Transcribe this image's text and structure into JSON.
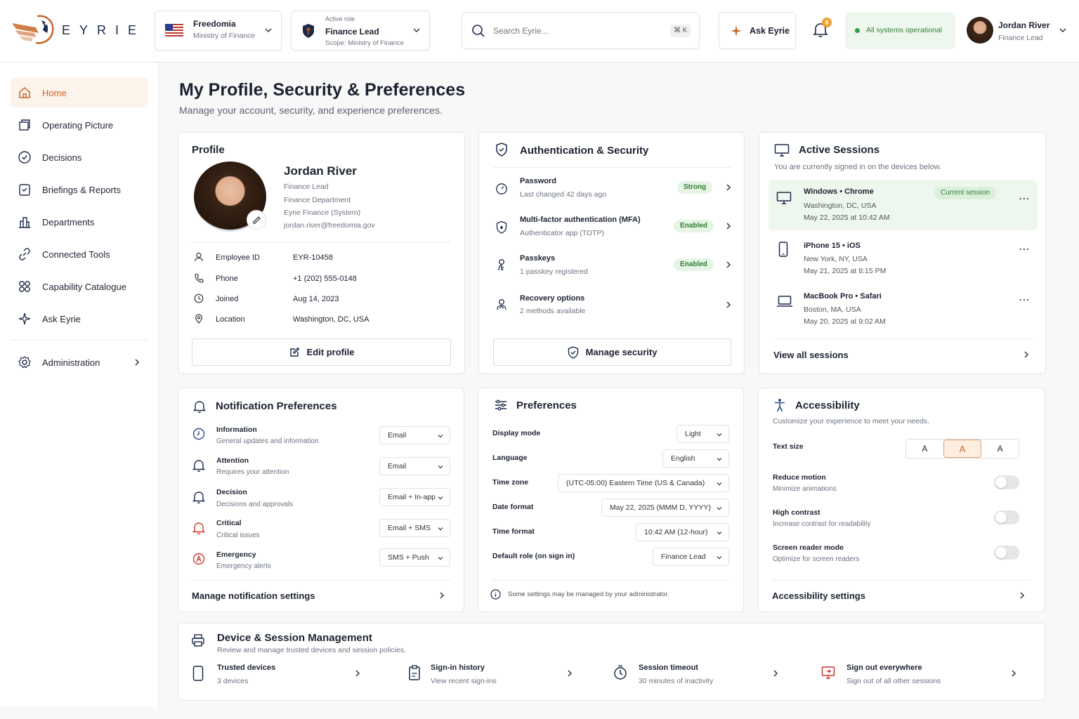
{
  "brand": {
    "name": "EYRIE"
  },
  "org": {
    "name": "Freedomia",
    "ministry": "Ministry of Finance"
  },
  "role": {
    "caption": "Active role",
    "name": "Finance Lead",
    "scope": "Scope: Ministry of Finance"
  },
  "search": {
    "placeholder": "Search Eyrie...",
    "shortcut": "⌘ K"
  },
  "ask": {
    "label": "Ask Eyrie"
  },
  "notifications": {
    "count": "8"
  },
  "status": {
    "label": "All systems operational"
  },
  "user": {
    "name": "Jordan River",
    "role": "Finance Lead"
  },
  "sidebar": {
    "items": [
      {
        "label": "Home",
        "icon": "home-icon"
      },
      {
        "label": "Operating Picture",
        "icon": "layers-icon"
      },
      {
        "label": "Decisions",
        "icon": "check-circle-icon"
      },
      {
        "label": "Briefings & Reports",
        "icon": "clipboard-icon"
      },
      {
        "label": "Departments",
        "icon": "building-icon"
      },
      {
        "label": "Connected Tools",
        "icon": "link-icon"
      },
      {
        "label": "Capability Catalogue",
        "icon": "grid-icon"
      },
      {
        "label": "Ask Eyrie",
        "icon": "sparkle-icon"
      }
    ],
    "admin": {
      "label": "Administration",
      "icon": "gear-icon"
    }
  },
  "page": {
    "title": "My Profile, Security & Preferences",
    "subtitle": "Manage your account, security, and experience preferences."
  },
  "profile": {
    "title": "Profile",
    "name": "Jordan River",
    "lines": [
      "Finance Lead",
      "Finance Department",
      "Eyrie Finance (System)",
      "jordan.river@freedomia.gov"
    ],
    "fields": [
      {
        "label": "Employee ID",
        "value": "EYR-10458",
        "icon": "person-icon"
      },
      {
        "label": "Phone",
        "value": "+1 (202) 555-0148",
        "icon": "phone-icon"
      },
      {
        "label": "Joined",
        "value": "Aug 14, 2023",
        "icon": "clock-icon"
      },
      {
        "label": "Location",
        "value": "Washington, DC, USA",
        "icon": "pin-icon"
      }
    ],
    "edit_label": "Edit profile"
  },
  "auth": {
    "title": "Authentication & Security",
    "items": [
      {
        "title": "Password",
        "sub": "Last changed 42 days ago",
        "badge": "Strong"
      },
      {
        "title": "Multi-factor authentication (MFA)",
        "sub": "Authenticator app (TOTP)",
        "badge": "Enabled"
      },
      {
        "title": "Passkeys",
        "sub": "1 passkey registered",
        "badge": "Enabled"
      },
      {
        "title": "Recovery options",
        "sub": "2 methods available",
        "badge": ""
      }
    ],
    "manage_label": "Manage security"
  },
  "sessions": {
    "title": "Active Sessions",
    "subtitle": "You are currently signed in on the devices below.",
    "items": [
      {
        "device": "Windows • Chrome",
        "location": "Washington, DC, USA",
        "time": "May 22, 2025 at 10:42 AM",
        "badge": "Current session"
      },
      {
        "device": "iPhone 15 • iOS",
        "location": "New York, NY, USA",
        "time": "May 21, 2025 at 8:15 PM"
      },
      {
        "device": "MacBook Pro • Safari",
        "location": "Boston, MA, USA",
        "time": "May 20, 2025 at 9:02 AM"
      }
    ],
    "view_all": "View all sessions"
  },
  "notifications_prefs": {
    "title": "Notification Preferences",
    "items": [
      {
        "title": "Information",
        "sub": "General updates and information",
        "value": "Email"
      },
      {
        "title": "Attention",
        "sub": "Requires your attention",
        "value": "Email"
      },
      {
        "title": "Decision",
        "sub": "Decisions and approvals",
        "value": "Email + In-app"
      },
      {
        "title": "Critical",
        "sub": "Critical issues",
        "value": "Email + SMS"
      },
      {
        "title": "Emergency",
        "sub": "Emergency alerts",
        "value": "SMS + Push"
      }
    ],
    "manage_label": "Manage notification settings"
  },
  "preferences": {
    "title": "Preferences",
    "items": [
      {
        "label": "Display mode",
        "value": "Light"
      },
      {
        "label": "Language",
        "value": "English"
      },
      {
        "label": "Time zone",
        "value": "(UTC-05:00) Eastern Time (US & Canada)"
      },
      {
        "label": "Date format",
        "value": "May 22, 2025 (MMM D, YYYY)"
      },
      {
        "label": "Time format",
        "value": "10:42 AM (12-hour)"
      },
      {
        "label": "Default role (on sign in)",
        "value": "Finance Lead"
      }
    ],
    "note": "Some settings may be managed by your administrator."
  },
  "accessibility": {
    "title": "Accessibility",
    "subtitle": "Customize your experience to meet your needs.",
    "text_size_label": "Text size",
    "text_sizes": [
      "A",
      "A",
      "A"
    ],
    "toggles": [
      {
        "title": "Reduce motion",
        "sub": "Minimize animations",
        "on": false
      },
      {
        "title": "High contrast",
        "sub": "Increase contrast for readability",
        "on": false
      },
      {
        "title": "Screen reader mode",
        "sub": "Optimize for screen readers",
        "on": false
      }
    ],
    "settings_label": "Accessibility settings"
  },
  "device_mgmt": {
    "title": "Device & Session Management",
    "subtitle": "Review and manage trusted devices and session policies.",
    "items": [
      {
        "title": "Trusted devices",
        "sub": "3 devices"
      },
      {
        "title": "Sign-in history",
        "sub": "View recent sign-ins"
      },
      {
        "title": "Session timeout",
        "sub": "30 minutes of inactivity"
      },
      {
        "title": "Sign out everywhere",
        "sub": "Sign out of all other sessions"
      }
    ]
  },
  "colors": {
    "accent": "#c8662a",
    "navy": "#1b2a4a",
    "success": "#2f7d32",
    "critical": "#d0342c"
  }
}
